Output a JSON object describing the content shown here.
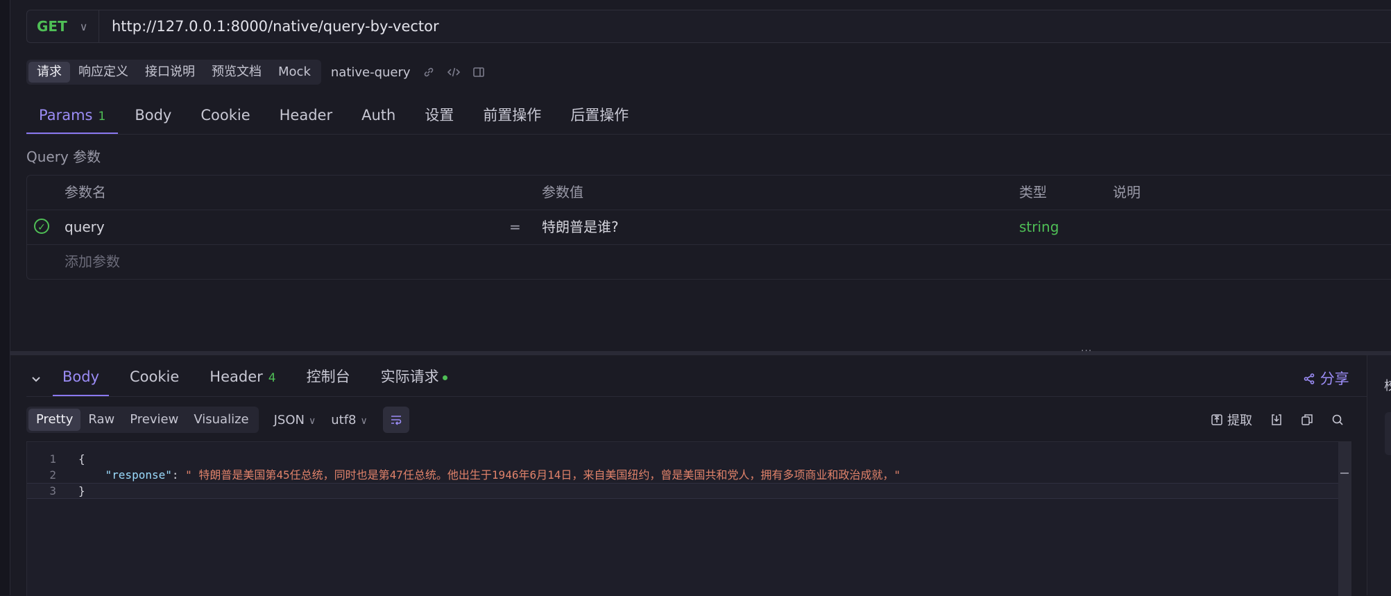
{
  "request": {
    "method": "GET",
    "url": "http://127.0.0.1:8000/native/query-by-vector"
  },
  "subbar": {
    "items": [
      "请求",
      "响应定义",
      "接口说明",
      "预览文档",
      "Mock"
    ],
    "active_index": 0,
    "api_name": "native-query"
  },
  "params_tabs": [
    {
      "label": "Params",
      "count": "1"
    },
    {
      "label": "Body"
    },
    {
      "label": "Cookie"
    },
    {
      "label": "Header"
    },
    {
      "label": "Auth"
    },
    {
      "label": "设置"
    },
    {
      "label": "前置操作"
    },
    {
      "label": "后置操作"
    }
  ],
  "query_section": {
    "title": "Query 参数",
    "headers": {
      "name": "参数名",
      "value": "参数值",
      "type": "类型",
      "desc": "说明"
    },
    "rows": [
      {
        "enabled": true,
        "name": "query",
        "eq": "=",
        "value": "特朗普是谁?",
        "type": "string",
        "desc": ""
      }
    ],
    "add_placeholder": "添加参数"
  },
  "response_tabs": [
    {
      "label": "Body"
    },
    {
      "label": "Cookie"
    },
    {
      "label": "Header",
      "count": "4"
    },
    {
      "label": "控制台"
    },
    {
      "label": "实际请求",
      "dot": true
    }
  ],
  "share_label": "分享",
  "right_panel_fragment": "校",
  "format_bar": {
    "views": [
      "Pretty",
      "Raw",
      "Preview",
      "Visualize"
    ],
    "active_index": 0,
    "format": "JSON",
    "encoding": "utf8",
    "extract_label": "提取"
  },
  "code_lines": [
    {
      "n": "1",
      "text": "{"
    },
    {
      "n": "2",
      "key": "\"response\"",
      "sep": ": ",
      "value": "\" 特朗普是美国第45任总统，同时也是第47任总统。他出生于1946年6月14日，来自美国纽约，曾是美国共和党人，拥有多项商业和政治成就，\""
    },
    {
      "n": "3",
      "text": "}"
    }
  ],
  "colors": {
    "accent": "#8a78f0",
    "success": "#4fbf56",
    "string": "#e0826a",
    "key": "#9cdcfe",
    "background": "#1b1b24"
  }
}
